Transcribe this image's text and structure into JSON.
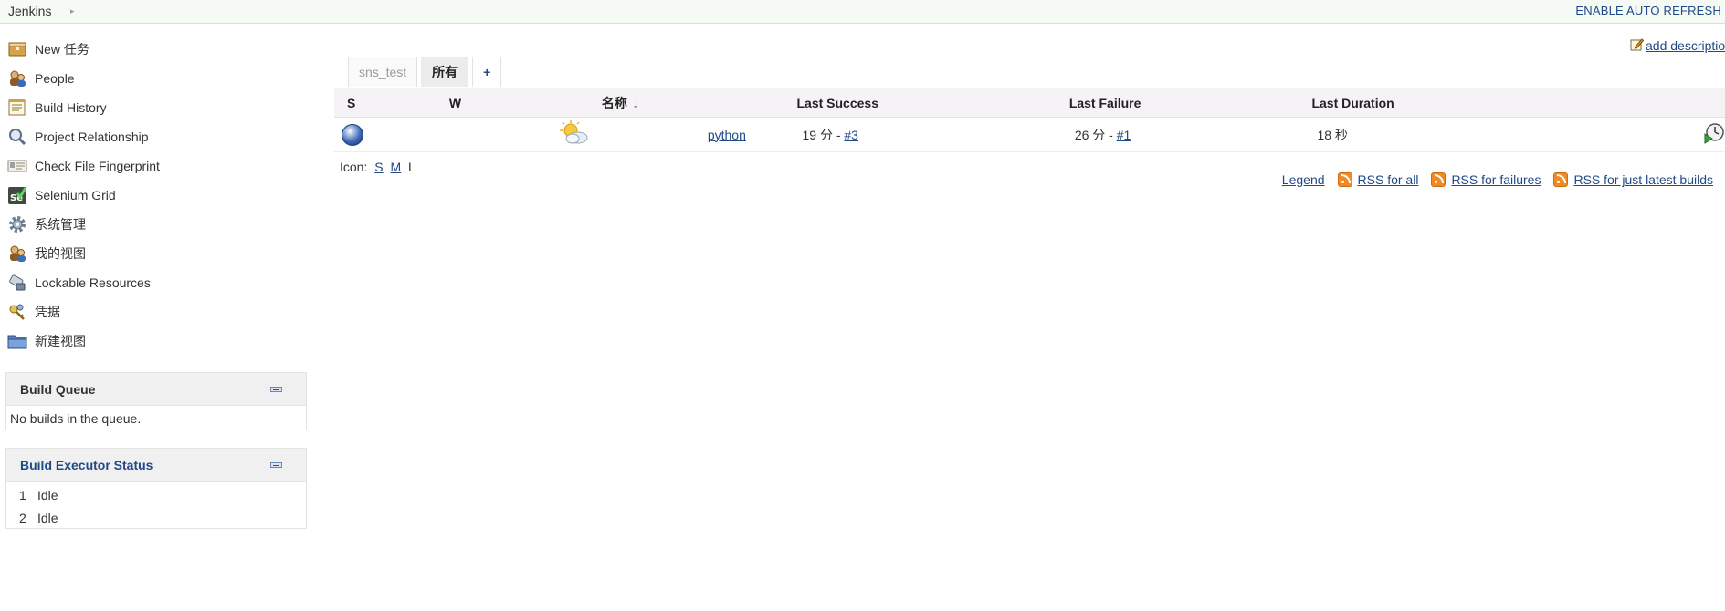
{
  "breadcrumb": {
    "root": "Jenkins"
  },
  "header": {
    "auto_refresh": "ENABLE AUTO REFRESH"
  },
  "sidebar": {
    "items": [
      {
        "label": "New 任务",
        "icon": "new-item-icon"
      },
      {
        "label": "People",
        "icon": "people-icon"
      },
      {
        "label": "Build History",
        "icon": "notepad-icon"
      },
      {
        "label": "Project Relationship",
        "icon": "search-icon"
      },
      {
        "label": "Check File Fingerprint",
        "icon": "fingerprint-icon"
      },
      {
        "label": "Selenium Grid",
        "icon": "selenium-icon"
      },
      {
        "label": "系统管理",
        "icon": "gear-icon"
      },
      {
        "label": "我的视图",
        "icon": "user-icon"
      },
      {
        "label": "Lockable Resources",
        "icon": "lock-icon"
      },
      {
        "label": "凭据",
        "icon": "key-icon"
      },
      {
        "label": "新建视图",
        "icon": "folder-icon"
      }
    ]
  },
  "build_queue": {
    "title": "Build Queue",
    "empty_text": "No builds in the queue."
  },
  "executor_status": {
    "title": "Build Executor Status",
    "executors": [
      {
        "number": "1",
        "status": "Idle"
      },
      {
        "number": "2",
        "status": "Idle"
      }
    ]
  },
  "add_description": "add description",
  "views": {
    "tabs": [
      {
        "label": "sns_test"
      },
      {
        "label": "所有",
        "active": true
      },
      {
        "label": "+"
      }
    ]
  },
  "jobs_table": {
    "headers": {
      "status": "S",
      "weather": "W",
      "name": "名称",
      "sort_arrow": "↓",
      "last_success": "Last Success",
      "last_failure": "Last Failure",
      "last_duration": "Last Duration"
    },
    "rows": [
      {
        "status_color": "blue",
        "name": "python",
        "last_success_time": "19 分 - ",
        "last_success_build": "#3",
        "last_failure_time": "26 分 - ",
        "last_failure_build": "#1",
        "last_duration": "18 秒"
      }
    ]
  },
  "icon_size": {
    "label": "Icon:",
    "options": [
      "S",
      "M",
      "L"
    ],
    "selected": "L"
  },
  "rss": {
    "legend": "Legend",
    "all": "RSS for all",
    "failures": "RSS for failures",
    "latest": "RSS for just latest builds"
  },
  "colors": {
    "link": "#204a87",
    "accent_rss": "#f08a24",
    "ball_blue": "#3d68b5"
  }
}
